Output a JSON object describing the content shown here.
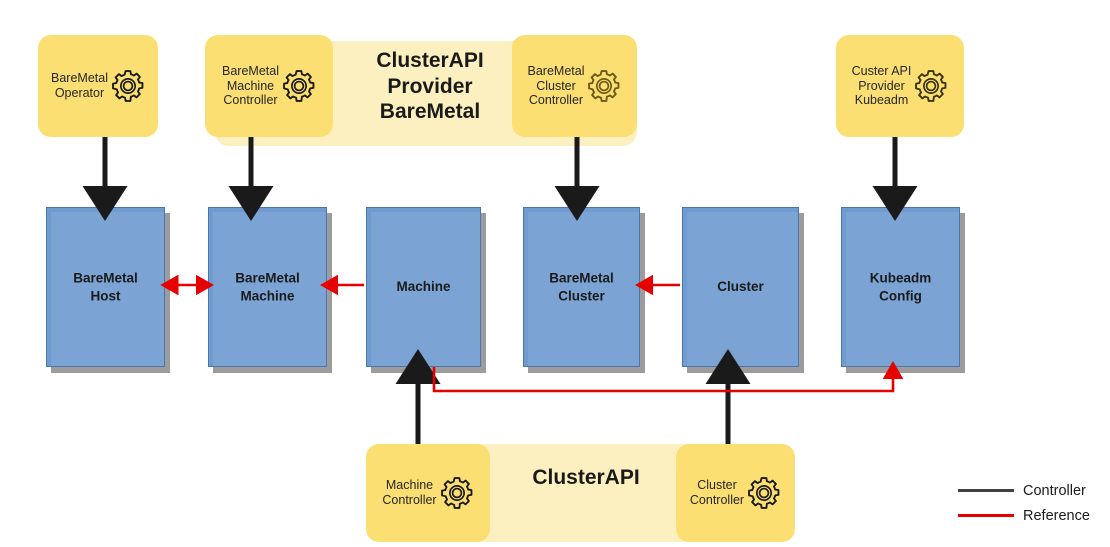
{
  "diagram": {
    "title": "ClusterAPI Provider BareMetal architecture",
    "colors": {
      "resource_fill": "#6f9bd1",
      "resource_border": "#4a76ab",
      "pod_fill": "#fbdf72",
      "band_fill": "#fdf0c0",
      "controller_line": "#404040",
      "reference_line": "#e60000"
    }
  },
  "bands": [
    {
      "id": "capbm",
      "label": "ClusterAPI\nProvider\nBareMetal"
    },
    {
      "id": "capi",
      "label": "ClusterAPI"
    }
  ],
  "controllers": [
    {
      "id": "baremetal-operator",
      "label": "BareMetal\nOperator",
      "icon": "gear-icon"
    },
    {
      "id": "baremetal-machine-controller",
      "label": "BareMetal\nMachine\nController",
      "icon": "gear-icon"
    },
    {
      "id": "baremetal-cluster-controller",
      "label": "BareMetal\nCluster\nController",
      "icon": "gear-icon"
    },
    {
      "id": "cluster-api-provider-kubeadm",
      "label": "Custer API\nProvider\nKubeadm",
      "icon": "gear-icon"
    },
    {
      "id": "machine-controller",
      "label": "Machine\nController",
      "icon": "gear-icon"
    },
    {
      "id": "cluster-controller",
      "label": "Cluster\nController",
      "icon": "gear-icon"
    }
  ],
  "resources": [
    {
      "id": "baremetal-host",
      "label": "BareMetal\nHost"
    },
    {
      "id": "baremetal-machine",
      "label": "BareMetal\nMachine"
    },
    {
      "id": "machine",
      "label": "Machine"
    },
    {
      "id": "baremetal-cluster",
      "label": "BareMetal\nCluster"
    },
    {
      "id": "cluster",
      "label": "Cluster"
    },
    {
      "id": "kubeadm-config",
      "label": "Kubeadm\nConfig"
    }
  ],
  "legend": {
    "items": [
      {
        "id": "controller",
        "label": "Controller",
        "color": "#404040"
      },
      {
        "id": "reference",
        "label": "Reference",
        "color": "#e60000"
      }
    ]
  },
  "edges": {
    "controller_edges": [
      {
        "from": "baremetal-operator",
        "to": "baremetal-host"
      },
      {
        "from": "baremetal-machine-controller",
        "to": "baremetal-machine"
      },
      {
        "from": "baremetal-cluster-controller",
        "to": "baremetal-cluster"
      },
      {
        "from": "cluster-api-provider-kubeadm",
        "to": "kubeadm-config"
      },
      {
        "from": "machine-controller",
        "to": "machine"
      },
      {
        "from": "cluster-controller",
        "to": "cluster"
      }
    ],
    "reference_edges": [
      {
        "from": "baremetal-host",
        "to": "baremetal-machine",
        "bidirectional": true
      },
      {
        "from": "machine",
        "to": "baremetal-machine",
        "bidirectional": false
      },
      {
        "from": "cluster",
        "to": "baremetal-cluster",
        "bidirectional": false
      },
      {
        "from": "machine",
        "to": "kubeadm-config",
        "bidirectional": false
      }
    ]
  }
}
